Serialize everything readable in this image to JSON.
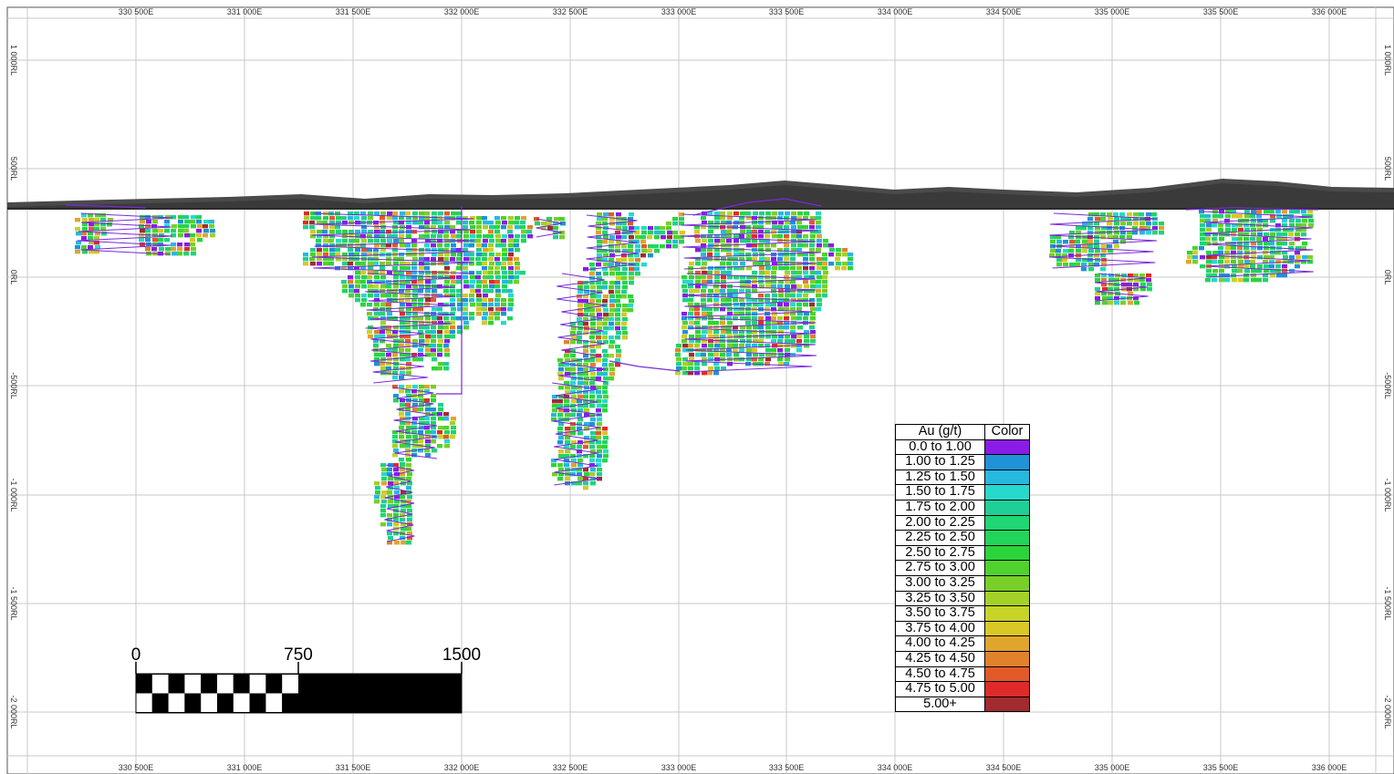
{
  "section": {
    "eastings": [
      "330 500E",
      "331 000E",
      "331 500E",
      "332 000E",
      "332 500E",
      "333 000E",
      "333 500E",
      "334 000E",
      "334 500E",
      "335 000E",
      "335 500E",
      "336 000E"
    ],
    "rls": [
      "1 000RL",
      "500RL",
      "0RL",
      "-500RL",
      "-1 000RL",
      "-1 500RL",
      "-2 000RL"
    ]
  },
  "scale_bar": {
    "labels": [
      "0",
      "750",
      "1500"
    ]
  },
  "legend": {
    "header": {
      "variable": "Au (g/t)",
      "color": "Color"
    },
    "rows": [
      {
        "label": "0.0 to 1.00",
        "color": "#8a1ce6"
      },
      {
        "label": "1.00 to 1.25",
        "color": "#1f92d8"
      },
      {
        "label": "1.25 to 1.50",
        "color": "#27b8e0"
      },
      {
        "label": "1.50 to 1.75",
        "color": "#26d9cc"
      },
      {
        "label": "1.75 to 2.00",
        "color": "#1fcf95"
      },
      {
        "label": "2.00 to 2.25",
        "color": "#1ed674"
      },
      {
        "label": "2.25 to 2.50",
        "color": "#22d45a"
      },
      {
        "label": "2.50 to 2.75",
        "color": "#2bd43a"
      },
      {
        "label": "2.75 to 3.00",
        "color": "#4fd22b"
      },
      {
        "label": "3.00 to 3.25",
        "color": "#78cf28"
      },
      {
        "label": "3.25 to 3.50",
        "color": "#a4d126"
      },
      {
        "label": "3.50 to 3.75",
        "color": "#c6d427"
      },
      {
        "label": "3.75 to 4.00",
        "color": "#d9c726"
      },
      {
        "label": "4.00 to 4.25",
        "color": "#e0a52c"
      },
      {
        "label": "4.25 to 4.50",
        "color": "#e0822c"
      },
      {
        "label": "4.50 to 4.75",
        "color": "#e2592a"
      },
      {
        "label": "4.75 to 5.00",
        "color": "#e02a2a"
      },
      {
        "label": "5.00+",
        "color": "#a12b2f"
      }
    ]
  },
  "colors": {
    "grid": "#c8c8c8",
    "trace": "#7a2ad8",
    "topography": "#4a4a4a"
  }
}
